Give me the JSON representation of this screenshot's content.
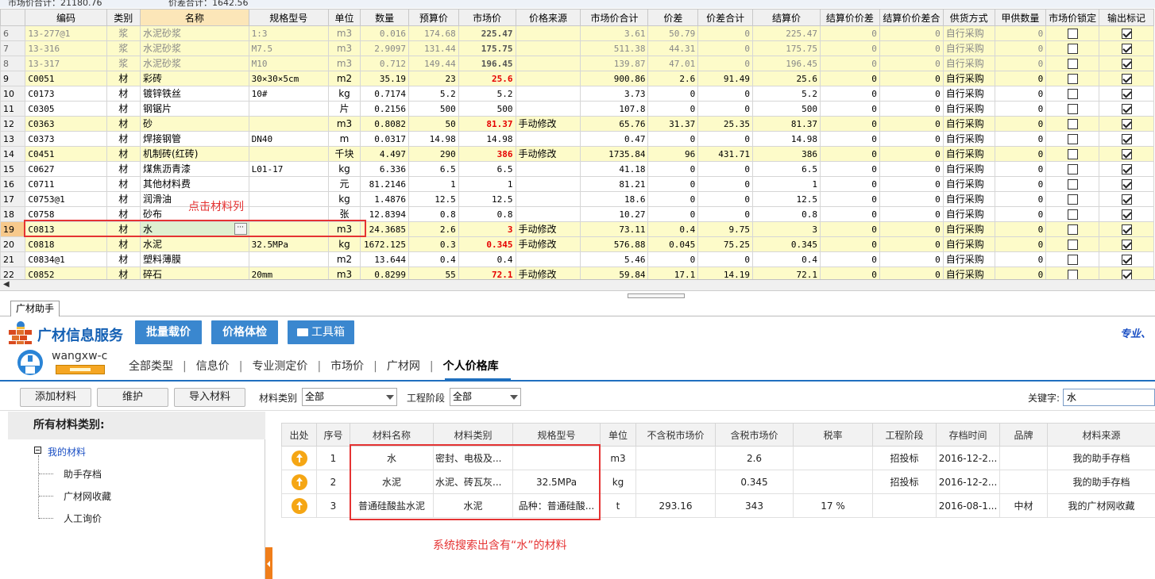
{
  "topbar": {
    "market_total": "市场价合计：21180.76",
    "diff_total": "价差合计：1642.56"
  },
  "grid": {
    "headers": [
      "编码",
      "类别",
      "名称",
      "规格型号",
      "单位",
      "数量",
      "预算价",
      "市场价",
      "价格来源",
      "市场价合计",
      "价差",
      "价差合计",
      "结算价",
      "结算价价差",
      "结算价价差合",
      "供货方式",
      "甲供数量",
      "市场价锁定",
      "输出标记"
    ],
    "rows": [
      {
        "rn": "6",
        "code": "13-277@1",
        "cat": "浆",
        "name": "水泥砂浆",
        "spec": "1:3",
        "unit": "m3",
        "qty": "0.016",
        "budget": "174.68",
        "market": "225.47",
        "src": "",
        "mtotal": "3.61",
        "diff": "50.79",
        "dtotal": "0",
        "settle": "225.47",
        "sdiff": "0",
        "sdtotal": "0",
        "supply": "自行采购",
        "jqty": "0",
        "lock": false,
        "out": true,
        "style": "y g7",
        "red": false,
        "bold": true
      },
      {
        "rn": "7",
        "code": "13-316",
        "cat": "浆",
        "name": "水泥砂浆",
        "spec": "M7.5",
        "unit": "m3",
        "qty": "2.9097",
        "budget": "131.44",
        "market": "175.75",
        "src": "",
        "mtotal": "511.38",
        "diff": "44.31",
        "dtotal": "0",
        "settle": "175.75",
        "sdiff": "0",
        "sdtotal": "0",
        "supply": "自行采购",
        "jqty": "0",
        "lock": false,
        "out": true,
        "style": "y g7",
        "red": false,
        "bold": true
      },
      {
        "rn": "8",
        "code": "13-317",
        "cat": "浆",
        "name": "水泥砂浆",
        "spec": "M10",
        "unit": "m3",
        "qty": "0.712",
        "budget": "149.44",
        "market": "196.45",
        "src": "",
        "mtotal": "139.87",
        "diff": "47.01",
        "dtotal": "0",
        "settle": "196.45",
        "sdiff": "0",
        "sdtotal": "0",
        "supply": "自行采购",
        "jqty": "0",
        "lock": false,
        "out": true,
        "style": "y g7",
        "red": false,
        "bold": true
      },
      {
        "rn": "9",
        "code": "C0051",
        "cat": "材",
        "name": "彩砖",
        "spec": "30×30×5cm",
        "unit": "m2",
        "qty": "35.19",
        "budget": "23",
        "market": "25.6",
        "src": "",
        "mtotal": "900.86",
        "diff": "2.6",
        "dtotal": "91.49",
        "settle": "25.6",
        "sdiff": "0",
        "sdtotal": "0",
        "supply": "自行采购",
        "jqty": "0",
        "lock": false,
        "out": true,
        "style": "y",
        "red": true,
        "bold": false
      },
      {
        "rn": "10",
        "code": "C0173",
        "cat": "材",
        "name": "镀锌铁丝",
        "spec": "10#",
        "unit": "kg",
        "qty": "0.7174",
        "budget": "5.2",
        "market": "5.2",
        "src": "",
        "mtotal": "3.73",
        "diff": "0",
        "dtotal": "0",
        "settle": "5.2",
        "sdiff": "0",
        "sdtotal": "0",
        "supply": "自行采购",
        "jqty": "0",
        "lock": false,
        "out": true,
        "style": "w",
        "red": false,
        "bold": false
      },
      {
        "rn": "11",
        "code": "C0305",
        "cat": "材",
        "name": "钢锯片",
        "spec": "",
        "unit": "片",
        "qty": "0.2156",
        "budget": "500",
        "market": "500",
        "src": "",
        "mtotal": "107.8",
        "diff": "0",
        "dtotal": "0",
        "settle": "500",
        "sdiff": "0",
        "sdtotal": "0",
        "supply": "自行采购",
        "jqty": "0",
        "lock": false,
        "out": true,
        "style": "w",
        "red": false,
        "bold": false
      },
      {
        "rn": "12",
        "code": "C0363",
        "cat": "材",
        "name": "砂",
        "spec": "",
        "unit": "m3",
        "qty": "0.8082",
        "budget": "50",
        "market": "81.37",
        "src": "手动修改",
        "mtotal": "65.76",
        "diff": "31.37",
        "dtotal": "25.35",
        "settle": "81.37",
        "sdiff": "0",
        "sdtotal": "0",
        "supply": "自行采购",
        "jqty": "0",
        "lock": false,
        "out": true,
        "style": "y",
        "red": true,
        "bold": false
      },
      {
        "rn": "13",
        "code": "C0373",
        "cat": "材",
        "name": "焊接钢管",
        "spec": "DN40",
        "unit": "m",
        "qty": "0.0317",
        "budget": "14.98",
        "market": "14.98",
        "src": "",
        "mtotal": "0.47",
        "diff": "0",
        "dtotal": "0",
        "settle": "14.98",
        "sdiff": "0",
        "sdtotal": "0",
        "supply": "自行采购",
        "jqty": "0",
        "lock": false,
        "out": true,
        "style": "w",
        "red": false,
        "bold": false
      },
      {
        "rn": "14",
        "code": "C0451",
        "cat": "材",
        "name": "机制砖(红砖)",
        "spec": "",
        "unit": "千块",
        "qty": "4.497",
        "budget": "290",
        "market": "386",
        "src": "手动修改",
        "mtotal": "1735.84",
        "diff": "96",
        "dtotal": "431.71",
        "settle": "386",
        "sdiff": "0",
        "sdtotal": "0",
        "supply": "自行采购",
        "jqty": "0",
        "lock": false,
        "out": true,
        "style": "y",
        "red": true,
        "bold": false
      },
      {
        "rn": "15",
        "code": "C0627",
        "cat": "材",
        "name": "煤焦沥青漆",
        "spec": "L01-17",
        "unit": "kg",
        "qty": "6.336",
        "budget": "6.5",
        "market": "6.5",
        "src": "",
        "mtotal": "41.18",
        "diff": "0",
        "dtotal": "0",
        "settle": "6.5",
        "sdiff": "0",
        "sdtotal": "0",
        "supply": "自行采购",
        "jqty": "0",
        "lock": false,
        "out": true,
        "style": "w",
        "red": false,
        "bold": false
      },
      {
        "rn": "16",
        "code": "C0711",
        "cat": "材",
        "name": "其他材料费",
        "spec": "",
        "unit": "元",
        "qty": "81.2146",
        "budget": "1",
        "market": "1",
        "src": "",
        "mtotal": "81.21",
        "diff": "0",
        "dtotal": "0",
        "settle": "1",
        "sdiff": "0",
        "sdtotal": "0",
        "supply": "自行采购",
        "jqty": "0",
        "lock": false,
        "out": true,
        "style": "w",
        "red": false,
        "bold": false
      },
      {
        "rn": "17",
        "code": "C0753@1",
        "cat": "材",
        "name": "润滑油",
        "spec": "",
        "unit": "kg",
        "qty": "1.4876",
        "budget": "12.5",
        "market": "12.5",
        "src": "",
        "mtotal": "18.6",
        "diff": "0",
        "dtotal": "0",
        "settle": "12.5",
        "sdiff": "0",
        "sdtotal": "0",
        "supply": "自行采购",
        "jqty": "0",
        "lock": false,
        "out": true,
        "style": "w",
        "red": false,
        "bold": false
      },
      {
        "rn": "18",
        "code": "C0758",
        "cat": "材",
        "name": "砂布",
        "spec": "",
        "unit": "张",
        "qty": "12.8394",
        "budget": "0.8",
        "market": "0.8",
        "src": "",
        "mtotal": "10.27",
        "diff": "0",
        "dtotal": "0",
        "settle": "0.8",
        "sdiff": "0",
        "sdtotal": "0",
        "supply": "自行采购",
        "jqty": "0",
        "lock": false,
        "out": true,
        "style": "w",
        "red": false,
        "bold": false
      },
      {
        "rn": "19",
        "code": "C0813",
        "cat": "材",
        "name": "水",
        "spec": "",
        "unit": "m3",
        "qty": "24.3685",
        "budget": "2.6",
        "market": "3",
        "src": "手动修改",
        "mtotal": "73.11",
        "diff": "0.4",
        "dtotal": "9.75",
        "settle": "3",
        "sdiff": "0",
        "sdtotal": "0",
        "supply": "自行采购",
        "jqty": "0",
        "lock": false,
        "out": true,
        "style": "y cur",
        "red": true,
        "bold": false
      },
      {
        "rn": "20",
        "code": "C0818",
        "cat": "材",
        "name": "水泥",
        "spec": "32.5MPa",
        "unit": "kg",
        "qty": "1672.125",
        "budget": "0.3",
        "market": "0.345",
        "src": "手动修改",
        "mtotal": "576.88",
        "diff": "0.045",
        "dtotal": "75.25",
        "settle": "0.345",
        "sdiff": "0",
        "sdtotal": "0",
        "supply": "自行采购",
        "jqty": "0",
        "lock": false,
        "out": true,
        "style": "y",
        "red": true,
        "bold": false
      },
      {
        "rn": "21",
        "code": "C0834@1",
        "cat": "材",
        "name": "塑料薄膜",
        "spec": "",
        "unit": "m2",
        "qty": "13.644",
        "budget": "0.4",
        "market": "0.4",
        "src": "",
        "mtotal": "5.46",
        "diff": "0",
        "dtotal": "0",
        "settle": "0.4",
        "sdiff": "0",
        "sdtotal": "0",
        "supply": "自行采购",
        "jqty": "0",
        "lock": false,
        "out": true,
        "style": "w",
        "red": false,
        "bold": false
      },
      {
        "rn": "22",
        "code": "C0852",
        "cat": "材",
        "name": "碎石",
        "spec": "20mm",
        "unit": "m3",
        "qty": "0.8299",
        "budget": "55",
        "market": "72.1",
        "src": "手动修改",
        "mtotal": "59.84",
        "diff": "17.1",
        "dtotal": "14.19",
        "settle": "72.1",
        "sdiff": "0",
        "sdtotal": "0",
        "supply": "自行采购",
        "jqty": "0",
        "lock": false,
        "out": true,
        "style": "y",
        "red": true,
        "bold": false
      }
    ]
  },
  "annotations": {
    "click_material": "点击材料列",
    "search_result": "系统搜索出含有“水”的材料"
  },
  "bottom_tab": "广材助手",
  "brand": {
    "title": "广材信息服务",
    "btn_batch": "批量载价",
    "btn_check": "价格体检",
    "btn_tools": "工具箱",
    "slogan": "专业、"
  },
  "user": {
    "name": "wangxw-c"
  },
  "nav": {
    "tabs": [
      "全部类型",
      "信息价",
      "专业测定价",
      "市场价",
      "广材网",
      "个人价格库"
    ],
    "active_index": 5
  },
  "toolbar": {
    "add": "添加材料",
    "maintain": "维护",
    "import": "导入材料",
    "cat_label": "材料类别",
    "cat_value": "全部",
    "stage_label": "工程阶段",
    "stage_value": "全部",
    "kw_label": "关键字:",
    "kw_value": "水"
  },
  "tree": {
    "head": "所有材料类别:",
    "root": "我的材料",
    "children": [
      "助手存档",
      "广材网收藏",
      "人工询价"
    ]
  },
  "results": {
    "headers": [
      "出处",
      "序号",
      "材料名称",
      "材料类别",
      "规格型号",
      "单位",
      "不含税市场价",
      "含税市场价",
      "税率",
      "工程阶段",
      "存档时间",
      "品牌",
      "材料来源"
    ],
    "rows": [
      {
        "seq": "1",
        "name": "水",
        "cat": "密封、电极及...",
        "spec": "",
        "unit": "m3",
        "ex": "",
        "inc": "2.6",
        "tax": "",
        "stage": "招投标",
        "time": "2016-12-2...",
        "brand": "",
        "src": "我的助手存档"
      },
      {
        "seq": "2",
        "name": "水泥",
        "cat": "水泥、砖瓦灰...",
        "spec": "32.5MPa",
        "unit": "kg",
        "ex": "",
        "inc": "0.345",
        "tax": "",
        "stage": "招投标",
        "time": "2016-12-2...",
        "brand": "",
        "src": "我的助手存档"
      },
      {
        "seq": "3",
        "name": "普通硅酸盐水泥",
        "cat": "水泥",
        "spec": "品种：普通硅酸...",
        "unit": "t",
        "ex": "293.16",
        "inc": "343",
        "tax": "17 %",
        "stage": "",
        "time": "2016-08-1...",
        "brand": "中材",
        "src": "我的广材网收藏"
      }
    ]
  },
  "colors": {
    "accent": "#3a87cf",
    "annotation": "#e53333",
    "row_yellow": "#fdfbc9",
    "icon_orange": "#f5a614"
  }
}
